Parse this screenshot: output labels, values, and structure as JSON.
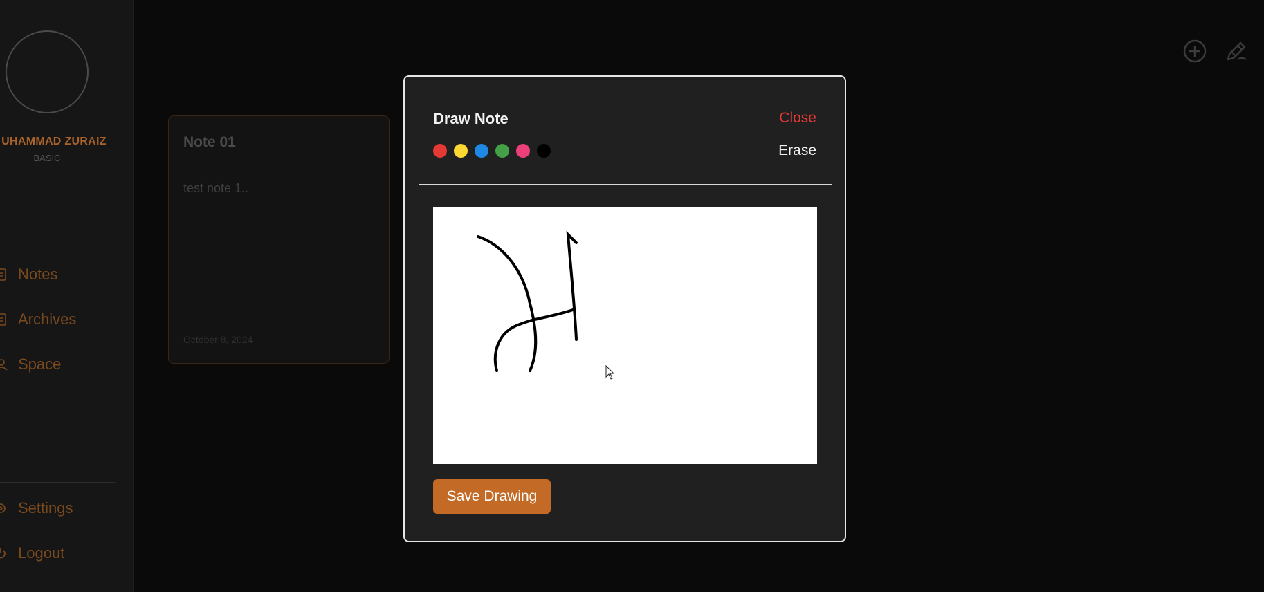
{
  "sidebar": {
    "user_name": "UHAMMAD ZURAIZ",
    "user_plan": "BASIC",
    "nav": [
      {
        "label": "Notes",
        "icon": "notes-icon"
      },
      {
        "label": "Archives",
        "icon": "archive-icon"
      },
      {
        "label": "Space",
        "icon": "user-icon"
      }
    ],
    "bottom_nav": [
      {
        "label": "Settings",
        "icon": "gear-icon"
      },
      {
        "label": "Logout",
        "icon": "power-icon"
      }
    ]
  },
  "note": {
    "title": "Note 01",
    "body": "test note 1..",
    "date": "October 8, 2024"
  },
  "top_actions": [
    {
      "icon": "add-circle-icon"
    },
    {
      "icon": "draw-pencil-icon"
    }
  ],
  "modal": {
    "title": "Draw Note",
    "close_label": "Close",
    "erase_label": "Erase",
    "colors": [
      "#e53935",
      "#fdd835",
      "#1e88e5",
      "#43a047",
      "#ec407a",
      "#000000"
    ],
    "save_label": "Save Drawing"
  },
  "theme": {
    "accent": "#c26a26",
    "danger": "#e53935"
  }
}
